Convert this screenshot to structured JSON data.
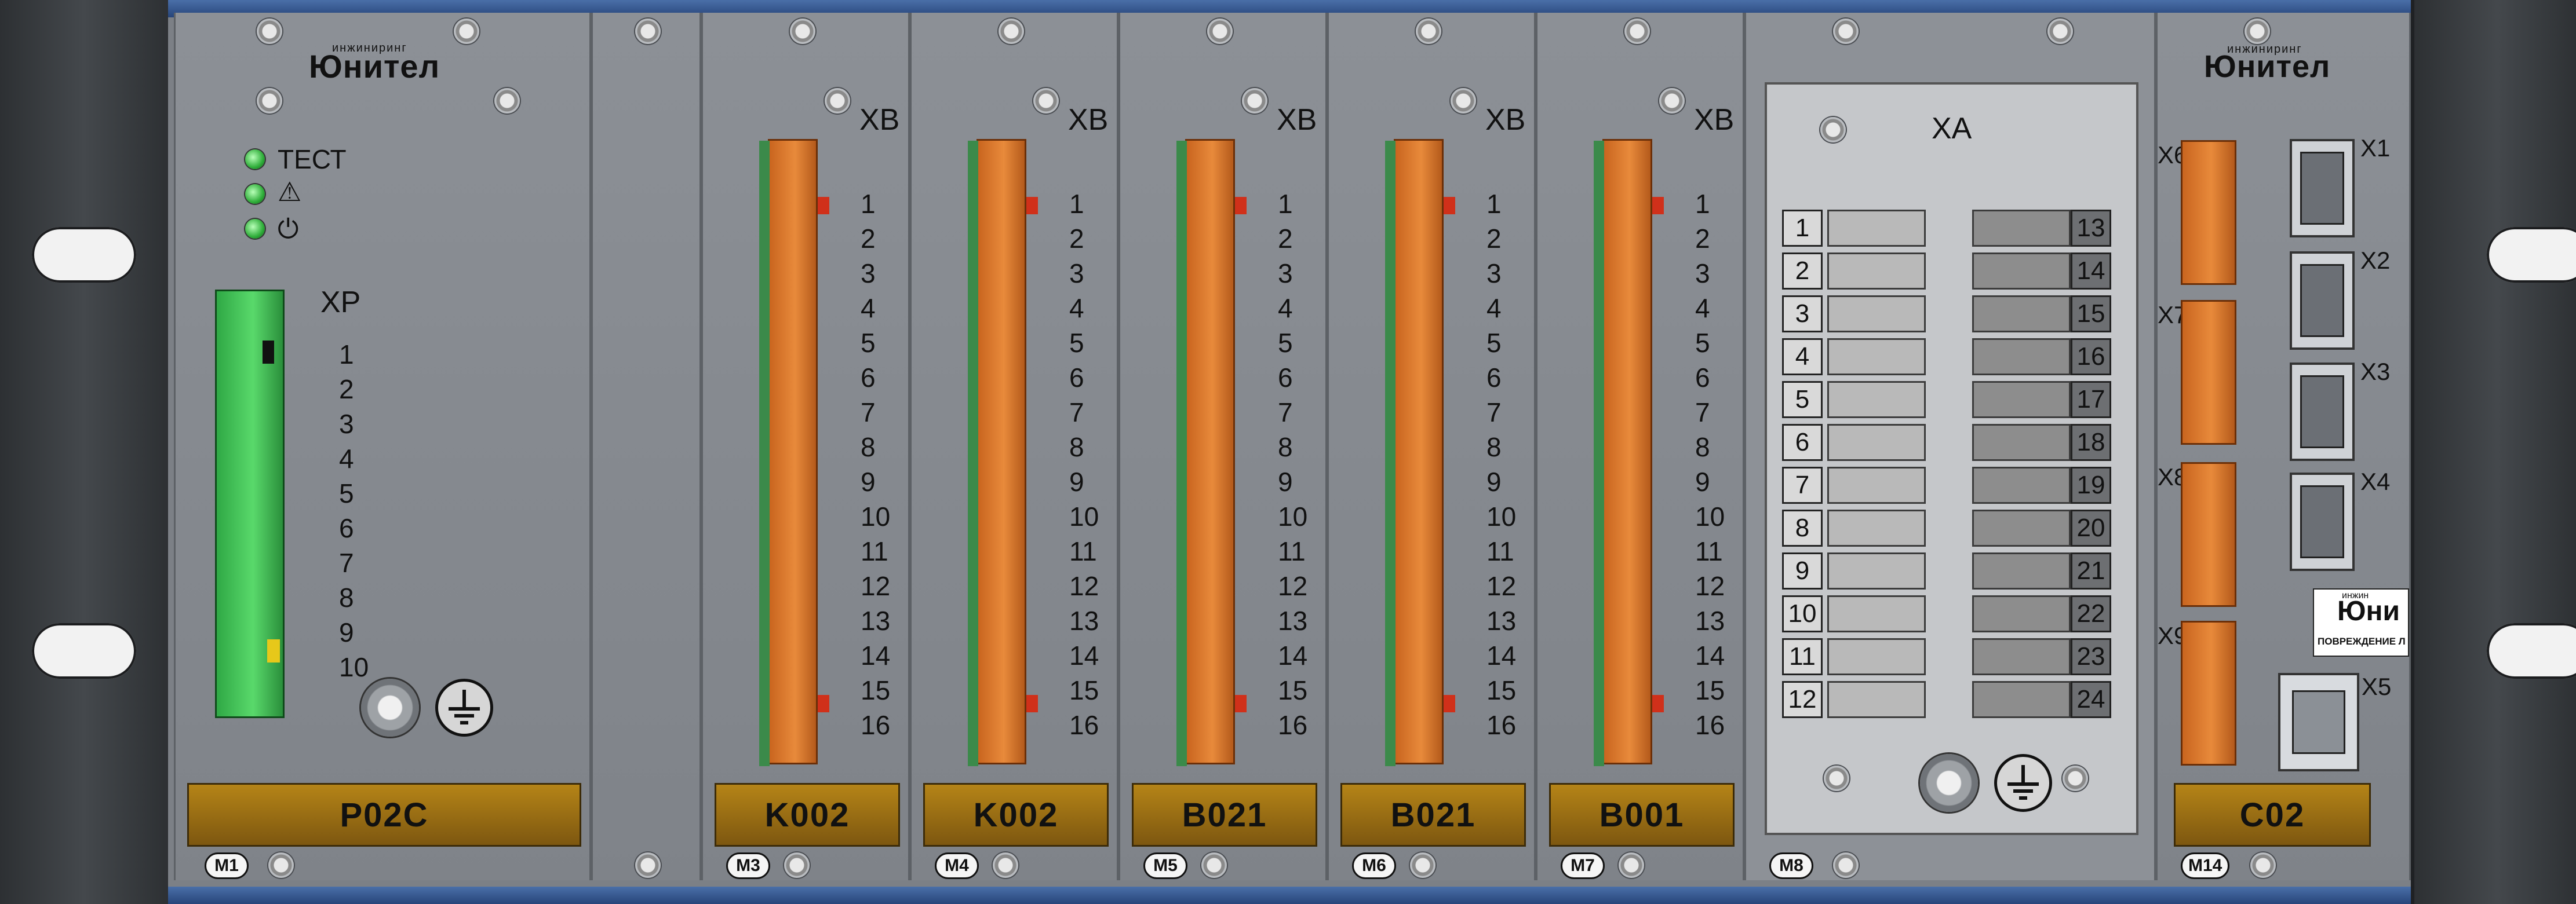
{
  "modules": {
    "m1": {
      "tag": "M1",
      "label": "P02C",
      "logo": "Юнител",
      "logo_sup": "инжиниринг",
      "leds": [
        "ТЕСТ",
        "⚠",
        "⏻"
      ],
      "connector": "XP",
      "pins": [
        "1",
        "2",
        "3",
        "4",
        "5",
        "6",
        "7",
        "8",
        "9",
        "10"
      ]
    },
    "m3": {
      "tag": "M3",
      "label": "K002",
      "connector": "XB"
    },
    "m4": {
      "tag": "M4",
      "label": "K002",
      "connector": "XB"
    },
    "m5": {
      "tag": "M5",
      "label": "B021",
      "connector": "XB"
    },
    "m6": {
      "tag": "M6",
      "label": "B021",
      "connector": "XB"
    },
    "m7": {
      "tag": "M7",
      "label": "B001",
      "connector": "XB"
    },
    "m8": {
      "tag": "M8",
      "connector": "XA",
      "left_terminals": [
        "1",
        "2",
        "3",
        "4",
        "5",
        "6",
        "7",
        "8",
        "9",
        "10",
        "11",
        "12"
      ],
      "right_terminals": [
        "13",
        "14",
        "15",
        "16",
        "17",
        "18",
        "19",
        "20",
        "21",
        "22",
        "23",
        "24"
      ]
    },
    "m14": {
      "tag": "M14",
      "label": "C02",
      "logo": "Юнител",
      "logo_sup": "инжиниринг",
      "connectors_left": [
        "X6",
        "X7",
        "X8",
        "X9"
      ],
      "ports_right": [
        "X1",
        "X2",
        "X3",
        "X4"
      ],
      "port_x5": "X5",
      "sticker_logo": "Юни",
      "sticker_sup": "инжин",
      "sticker_text": "ПОВРЕЖДЕНИЕ Л"
    }
  },
  "xb_pins": [
    "1",
    "2",
    "3",
    "4",
    "5",
    "6",
    "7",
    "8",
    "9",
    "10",
    "11",
    "12",
    "13",
    "14",
    "15",
    "16"
  ]
}
